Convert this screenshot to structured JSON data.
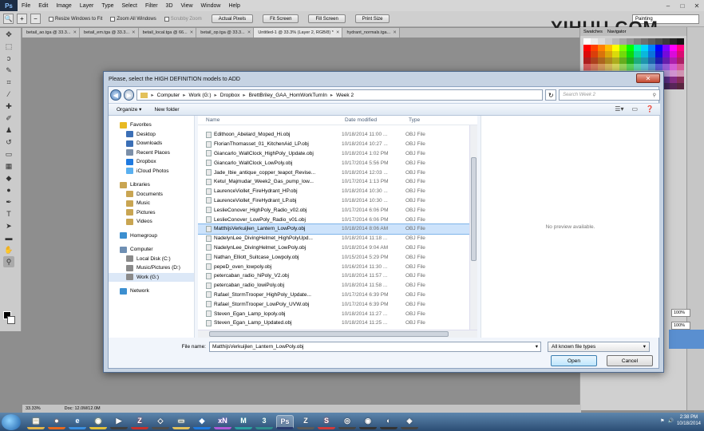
{
  "app": {
    "logo": "Ps",
    "menu": [
      "File",
      "Edit",
      "Image",
      "Layer",
      "Type",
      "Select",
      "Filter",
      "3D",
      "View",
      "Window",
      "Help"
    ],
    "window_controls": [
      "–",
      "□",
      "✕"
    ]
  },
  "options_bar": {
    "checkboxes": [
      "Resize Windows to Fit",
      "Zoom All Windows",
      "Scrubby Zoom"
    ],
    "buttons": [
      "Actual Pixels",
      "Fit Screen",
      "Fill Screen",
      "Print Size"
    ],
    "workspace": "Painting"
  },
  "watermark": "YIHUU.COM",
  "doc_tabs": [
    {
      "label": "betail_ao.tga @ 33.3..."
    },
    {
      "label": "betail_em.tga @ 33.3..."
    },
    {
      "label": "betail_local.tga @ 66..."
    },
    {
      "label": "betail_op.tga @ 33.3..."
    },
    {
      "label": "Untitled-1 @ 33.3% (Layer 2, RGB/8) *",
      "active": true
    },
    {
      "label": "hydrant_normals.tga..."
    }
  ],
  "panels": {
    "tabs": [
      "Swatches",
      "Navigator"
    ]
  },
  "right_panel": {
    "zoom_values": [
      "100%",
      "100%",
      "100%"
    ]
  },
  "status": {
    "zoom": "33.33%",
    "doc": "Doc: 12.0M/12.0M"
  },
  "dialog": {
    "title": "Please, select the HIGH DEFINITION models to ADD",
    "close": "✕",
    "breadcrumb": [
      "Computer",
      "Work (G:)",
      "Dropbox",
      "BrettBriley_GAA_HomWorkTurnIn",
      "Week 2"
    ],
    "search_placeholder": "Search Week 2",
    "organize": "Organize ▾",
    "new_folder": "New folder",
    "nav": [
      {
        "label": "Favorites",
        "kind": "head",
        "color": "#e8b923"
      },
      {
        "label": "Desktop",
        "kind": "sub",
        "color": "#3b6fb6"
      },
      {
        "label": "Downloads",
        "kind": "sub",
        "color": "#3b6fb6"
      },
      {
        "label": "Recent Places",
        "kind": "sub",
        "color": "#7b8fa8"
      },
      {
        "label": "Dropbox",
        "kind": "sub",
        "color": "#1f7ae0"
      },
      {
        "label": "iCloud Photos",
        "kind": "sub",
        "color": "#5ab0f0"
      },
      {
        "kind": "gap"
      },
      {
        "label": "Libraries",
        "kind": "head",
        "color": "#c9a552"
      },
      {
        "label": "Documents",
        "kind": "sub",
        "color": "#c9a552"
      },
      {
        "label": "Music",
        "kind": "sub",
        "color": "#c9a552"
      },
      {
        "label": "Pictures",
        "kind": "sub",
        "color": "#c9a552"
      },
      {
        "label": "Videos",
        "kind": "sub",
        "color": "#c9a552"
      },
      {
        "kind": "gap"
      },
      {
        "label": "Homegroup",
        "kind": "head",
        "color": "#3c8fd0"
      },
      {
        "kind": "gap"
      },
      {
        "label": "Computer",
        "kind": "head",
        "color": "#6f8fb3"
      },
      {
        "label": "Local Disk (C:)",
        "kind": "sub",
        "color": "#8a8a8a"
      },
      {
        "label": "Music/Pictures (D:)",
        "kind": "sub",
        "color": "#8a8a8a"
      },
      {
        "label": "Work (G:)",
        "kind": "sub",
        "color": "#8a8a8a",
        "selected": true
      },
      {
        "kind": "gap"
      },
      {
        "label": "Network",
        "kind": "head",
        "color": "#3c8fd0"
      }
    ],
    "columns": [
      "Name",
      "Date modified",
      "Type"
    ],
    "files": [
      {
        "name": "Edithoon_Abelard_Moped_Hi.obj",
        "date": "10/18/2014 11:00 ...",
        "type": "OBJ File"
      },
      {
        "name": "FlorianThomasset_01_KitchenAid_LP.obj",
        "date": "10/18/2014 10:27 ...",
        "type": "OBJ File"
      },
      {
        "name": "Giancarlo_WallClock_HighPoly_Update.obj",
        "date": "10/18/2014 1:02 PM",
        "type": "OBJ File"
      },
      {
        "name": "Giancarlo_WallClock_LowPoly.obj",
        "date": "10/17/2014 5:56 PM",
        "type": "OBJ File"
      },
      {
        "name": "Jade_Ibie_antique_copper_teapot_Revise...",
        "date": "10/18/2014 12:03 ...",
        "type": "OBJ File"
      },
      {
        "name": "Ketul_Majmudar_Week2_Gas_pump_low...",
        "date": "10/17/2014 1:13 PM",
        "type": "OBJ File"
      },
      {
        "name": "LaurenceViollet_FireHydrant_HP.obj",
        "date": "10/18/2014 10:30 ...",
        "type": "OBJ File"
      },
      {
        "name": "LaurenceViollet_FireHydrant_LP.obj",
        "date": "10/18/2014 10:30 ...",
        "type": "OBJ File"
      },
      {
        "name": "LeslieConover_HighPoly_Radio_v02.obj",
        "date": "10/17/2014 6:06 PM",
        "type": "OBJ File"
      },
      {
        "name": "LeslieConover_LowPoly_Radio_v01.obj",
        "date": "10/17/2014 6:06 PM",
        "type": "OBJ File"
      },
      {
        "name": "MatthijsVerkuijlen_Lantern_LowPoly.obj",
        "date": "10/18/2014 8:06 AM",
        "type": "OBJ File",
        "selected": true
      },
      {
        "name": "NadelynLee_DivingHelmet_HighPolyUpd...",
        "date": "10/18/2014 11:18 ...",
        "type": "OBJ File"
      },
      {
        "name": "NadelynLee_DivingHelmet_LowPoly.obj",
        "date": "10/18/2014 9:04 AM",
        "type": "OBJ File"
      },
      {
        "name": "Nathan_Elliott_Suitcase_Lowpoly.obj",
        "date": "10/15/2014 5:29 PM",
        "type": "OBJ File"
      },
      {
        "name": "pepeD_oven_lowpoly.obj",
        "date": "10/16/2014 11:30 ...",
        "type": "OBJ File"
      },
      {
        "name": "petercaban_radio_hiPoly_V2.obj",
        "date": "10/18/2014 11:57 ...",
        "type": "OBJ File"
      },
      {
        "name": "petercaban_radio_lowiPoly.obj",
        "date": "10/18/2014 11:58 ...",
        "type": "OBJ File"
      },
      {
        "name": "Rafael_StormTrooper_HighPoly_Update...",
        "date": "10/17/2014 6:39 PM",
        "type": "OBJ File"
      },
      {
        "name": "Rafael_StormTrooper_LowPoly_UVW.obj",
        "date": "10/17/2014 6:39 PM",
        "type": "OBJ File"
      },
      {
        "name": "Steven_Egan_Lamp_lopoly.obj",
        "date": "10/18/2014 11:27 ...",
        "type": "OBJ File"
      },
      {
        "name": "Steven_Egan_Lamp_Updated.obj",
        "date": "10/18/2014 11:25 ...",
        "type": "OBJ File"
      }
    ],
    "preview_text": "No preview available.",
    "file_name_label": "File name:",
    "file_name_value": "MatthijsVerkuijlen_Lantern_LowPoly.obj",
    "filter": "All known file types",
    "open": "Open",
    "cancel": "Cancel"
  },
  "taskbar": {
    "icons": [
      {
        "name": "explorer",
        "glyph": "▤",
        "color": "#e3b54a"
      },
      {
        "name": "firefox",
        "glyph": "●",
        "color": "#e6691f"
      },
      {
        "name": "ie",
        "glyph": "e",
        "color": "#3a8fe0"
      },
      {
        "name": "chrome",
        "glyph": "◉",
        "color": "#e3c13b"
      },
      {
        "name": "media",
        "glyph": "▶",
        "color": "#3f3f3f"
      },
      {
        "name": "filezilla",
        "glyph": "Z",
        "color": "#c6302b"
      },
      {
        "name": "unity",
        "glyph": "◇",
        "color": "#4d4d4d"
      },
      {
        "name": "folder",
        "glyph": "▭",
        "color": "#e3c15a"
      },
      {
        "name": "dropbox",
        "glyph": "◆",
        "color": "#1f7ae0"
      },
      {
        "name": "xnormal",
        "glyph": "xN",
        "color": "#b05ad8"
      },
      {
        "name": "maya",
        "glyph": "M",
        "color": "#2aa0a0"
      },
      {
        "name": "max",
        "glyph": "3",
        "color": "#2f8d8d"
      },
      {
        "name": "app",
        "glyph": "Ps",
        "color": "#2a3b6f",
        "active": true
      },
      {
        "name": "zbrush",
        "glyph": "Z",
        "color": "#5a5a5a"
      },
      {
        "name": "s",
        "glyph": "S",
        "color": "#d03b3b"
      },
      {
        "name": "t1",
        "glyph": "◎",
        "color": "#444"
      },
      {
        "name": "t2",
        "glyph": "◉",
        "color": "#333"
      },
      {
        "name": "t3",
        "glyph": "◐",
        "color": "#333"
      },
      {
        "name": "t4",
        "glyph": "◈",
        "color": "#444"
      }
    ],
    "time": "2:38 PM",
    "date": "10/18/2014"
  }
}
